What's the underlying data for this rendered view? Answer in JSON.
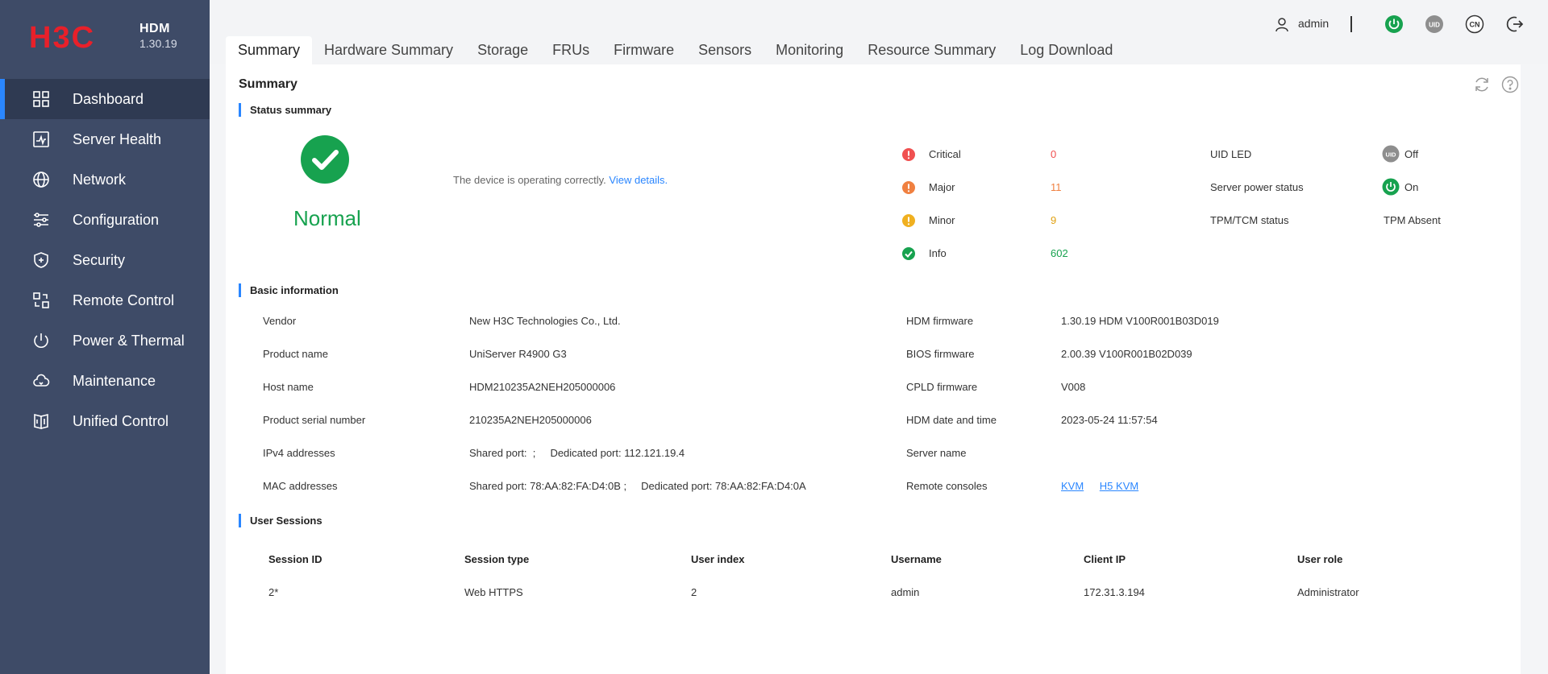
{
  "brand": {
    "logo_text": "H3C",
    "product": "HDM",
    "version": "1.30.19"
  },
  "sidebar": {
    "items": [
      {
        "label": "Dashboard",
        "icon": "dashboard-icon"
      },
      {
        "label": "Server Health",
        "icon": "health-icon"
      },
      {
        "label": "Network",
        "icon": "globe-icon"
      },
      {
        "label": "Configuration",
        "icon": "sliders-icon"
      },
      {
        "label": "Security",
        "icon": "shield-icon"
      },
      {
        "label": "Remote Control",
        "icon": "remote-icon"
      },
      {
        "label": "Power & Thermal",
        "icon": "power-icon"
      },
      {
        "label": "Maintenance",
        "icon": "cloud-icon"
      },
      {
        "label": "Unified Control",
        "icon": "unified-icon"
      }
    ],
    "active": "Dashboard"
  },
  "tabs": [
    "Summary",
    "Hardware Summary",
    "Storage",
    "FRUs",
    "Firmware",
    "Sensors",
    "Monitoring",
    "Resource Summary",
    "Log Download"
  ],
  "active_tab": "Summary",
  "header": {
    "username": "admin",
    "uid_label": "UID",
    "lang_label": "CN"
  },
  "main": {
    "title": "Summary",
    "status_summary": {
      "title": "Status summary",
      "state": "Normal",
      "message": "The device is operating correctly.",
      "link": "View details.",
      "alarms": [
        {
          "label": "Critical",
          "count": "0",
          "color": "#f05050"
        },
        {
          "label": "Major",
          "count": "11",
          "color": "#f08040"
        },
        {
          "label": "Minor",
          "count": "9",
          "color": "#f0b020"
        },
        {
          "label": "Info",
          "count": "602",
          "color": "#17a24f"
        }
      ],
      "uid_led": {
        "label": "UID LED",
        "value": "Off"
      },
      "power": {
        "label": "Server power status",
        "value": "On"
      },
      "tpm": {
        "label": "TPM/TCM status",
        "value": "TPM Absent"
      }
    },
    "basic": {
      "title": "Basic information",
      "left": [
        {
          "label": "Vendor",
          "value": "New H3C Technologies Co., Ltd."
        },
        {
          "label": "Product name",
          "value": "UniServer R4900 G3"
        },
        {
          "label": "Host name",
          "value": "HDM210235A2NEH205000006"
        },
        {
          "label": "Product serial number",
          "value": "210235A2NEH205000006"
        },
        {
          "label": "IPv4 addresses",
          "value": "Shared port:  ;     Dedicated port: 112.121.19.4"
        },
        {
          "label": "MAC addresses",
          "value": "Shared port: 78:AA:82:FA:D4:0B ;     Dedicated port: 78:AA:82:FA:D4:0A"
        }
      ],
      "right": [
        {
          "label": "HDM firmware",
          "value": "1.30.19 HDM V100R001B03D019"
        },
        {
          "label": "BIOS firmware",
          "value": "2.00.39 V100R001B02D039"
        },
        {
          "label": "CPLD firmware",
          "value": "V008"
        },
        {
          "label": "HDM date and time",
          "value": "2023-05-24 11:57:54"
        },
        {
          "label": "Server name",
          "value": ""
        },
        {
          "label": "Remote consoles",
          "value": ""
        }
      ],
      "consoles": [
        "KVM",
        "H5 KVM"
      ]
    },
    "sessions": {
      "title": "User Sessions",
      "columns": [
        "Session ID",
        "Session type",
        "User index",
        "Username",
        "Client IP",
        "User role"
      ],
      "rows": [
        [
          "2*",
          "Web HTTPS",
          "2",
          "admin",
          "172.31.3.194",
          "Administrator"
        ]
      ]
    }
  }
}
